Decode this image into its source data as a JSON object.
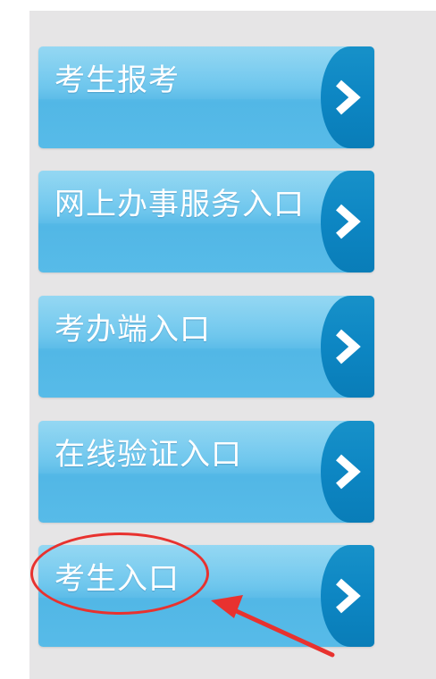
{
  "nav": {
    "items": [
      {
        "label": "考生报考"
      },
      {
        "label": "网上办事服务入口"
      },
      {
        "label": "考办端入口"
      },
      {
        "label": "在线验证入口"
      },
      {
        "label": "考生入口"
      }
    ]
  },
  "colors": {
    "button_light": "#63c2ec",
    "arrow_tab": "#0d86c3",
    "panel_bg": "#e6e5e6",
    "annotation": "#e8322f"
  },
  "icons": {
    "arrow": "chevron-right-icon"
  }
}
